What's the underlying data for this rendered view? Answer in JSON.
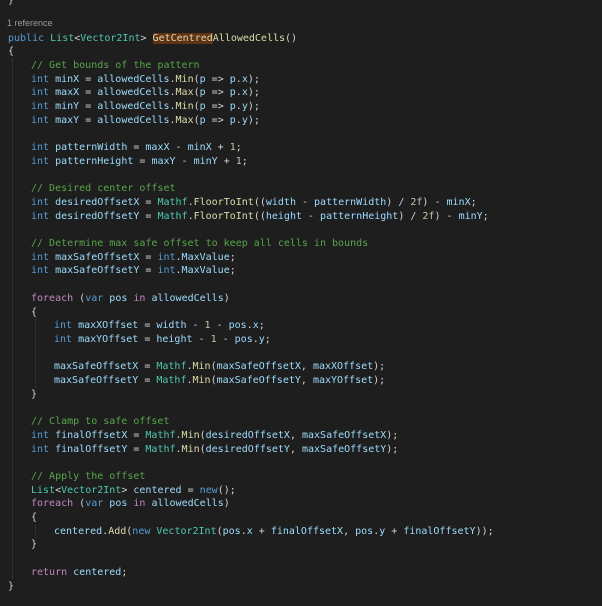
{
  "editor": {
    "code_lens": "1 reference",
    "colors": {
      "background": "#1e1e1e",
      "keyword": "#569cd6",
      "control": "#c586c0",
      "type": "#4ec9b0",
      "function": "#dcdcaa",
      "variable": "#9cdcfe",
      "number": "#b5cea8",
      "comment": "#57a64a",
      "text": "#d4d4d4",
      "highlight": "#613214"
    },
    "lines": [
      {
        "indent": 0,
        "tokens": [
          [
            "}",
            "pl"
          ]
        ]
      },
      {
        "indent": 0,
        "tokens": [
          [
            "public",
            "kw"
          ],
          [
            " ",
            "pl"
          ],
          [
            "List",
            "ty"
          ],
          [
            "<",
            "pl"
          ],
          [
            "Vector2Int",
            "ty"
          ],
          [
            "> ",
            "pl"
          ],
          [
            "GetCentred",
            "fn hl"
          ],
          [
            "AllowedCells",
            "fn"
          ],
          [
            "()",
            "pl"
          ]
        ]
      },
      {
        "indent": 0,
        "tokens": [
          [
            "{",
            "pl"
          ]
        ]
      },
      {
        "indent": 1,
        "tokens": [
          [
            "// Get bounds of the pattern",
            "cm"
          ]
        ]
      },
      {
        "indent": 1,
        "tokens": [
          [
            "int",
            "kw"
          ],
          [
            " ",
            "pl"
          ],
          [
            "minX",
            "vr"
          ],
          [
            " = ",
            "pl"
          ],
          [
            "allowedCells",
            "vr"
          ],
          [
            ".",
            "pl"
          ],
          [
            "Min",
            "fn"
          ],
          [
            "(",
            "pl"
          ],
          [
            "p",
            "vr"
          ],
          [
            " => ",
            "pl"
          ],
          [
            "p",
            "vr"
          ],
          [
            ".",
            "pl"
          ],
          [
            "x",
            "vr"
          ],
          [
            ");",
            "pl"
          ]
        ]
      },
      {
        "indent": 1,
        "tokens": [
          [
            "int",
            "kw"
          ],
          [
            " ",
            "pl"
          ],
          [
            "maxX",
            "vr"
          ],
          [
            " = ",
            "pl"
          ],
          [
            "allowedCells",
            "vr"
          ],
          [
            ".",
            "pl"
          ],
          [
            "Max",
            "fn"
          ],
          [
            "(",
            "pl"
          ],
          [
            "p",
            "vr"
          ],
          [
            " => ",
            "pl"
          ],
          [
            "p",
            "vr"
          ],
          [
            ".",
            "pl"
          ],
          [
            "x",
            "vr"
          ],
          [
            ");",
            "pl"
          ]
        ]
      },
      {
        "indent": 1,
        "tokens": [
          [
            "int",
            "kw"
          ],
          [
            " ",
            "pl"
          ],
          [
            "minY",
            "vr"
          ],
          [
            " = ",
            "pl"
          ],
          [
            "allowedCells",
            "vr"
          ],
          [
            ".",
            "pl"
          ],
          [
            "Min",
            "fn"
          ],
          [
            "(",
            "pl"
          ],
          [
            "p",
            "vr"
          ],
          [
            " => ",
            "pl"
          ],
          [
            "p",
            "vr"
          ],
          [
            ".",
            "pl"
          ],
          [
            "y",
            "vr"
          ],
          [
            ");",
            "pl"
          ]
        ]
      },
      {
        "indent": 1,
        "tokens": [
          [
            "int",
            "kw"
          ],
          [
            " ",
            "pl"
          ],
          [
            "maxY",
            "vr"
          ],
          [
            " = ",
            "pl"
          ],
          [
            "allowedCells",
            "vr"
          ],
          [
            ".",
            "pl"
          ],
          [
            "Max",
            "fn"
          ],
          [
            "(",
            "pl"
          ],
          [
            "p",
            "vr"
          ],
          [
            " => ",
            "pl"
          ],
          [
            "p",
            "vr"
          ],
          [
            ".",
            "pl"
          ],
          [
            "y",
            "vr"
          ],
          [
            ");",
            "pl"
          ]
        ]
      },
      {
        "indent": 0,
        "tokens": []
      },
      {
        "indent": 1,
        "tokens": [
          [
            "int",
            "kw"
          ],
          [
            " ",
            "pl"
          ],
          [
            "patternWidth",
            "vr"
          ],
          [
            " = ",
            "pl"
          ],
          [
            "maxX",
            "vr"
          ],
          [
            " - ",
            "pl"
          ],
          [
            "minX",
            "vr"
          ],
          [
            " + ",
            "pl"
          ],
          [
            "1",
            "nm"
          ],
          [
            ";",
            "pl"
          ]
        ]
      },
      {
        "indent": 1,
        "tokens": [
          [
            "int",
            "kw"
          ],
          [
            " ",
            "pl"
          ],
          [
            "patternHeight",
            "vr"
          ],
          [
            " = ",
            "pl"
          ],
          [
            "maxY",
            "vr"
          ],
          [
            " - ",
            "pl"
          ],
          [
            "minY",
            "vr"
          ],
          [
            " + ",
            "pl"
          ],
          [
            "1",
            "nm"
          ],
          [
            ";",
            "pl"
          ]
        ]
      },
      {
        "indent": 0,
        "tokens": []
      },
      {
        "indent": 1,
        "tokens": [
          [
            "// Desired center offset",
            "cm"
          ]
        ]
      },
      {
        "indent": 1,
        "tokens": [
          [
            "int",
            "kw"
          ],
          [
            " ",
            "pl"
          ],
          [
            "desiredOffsetX",
            "vr"
          ],
          [
            " = ",
            "pl"
          ],
          [
            "Mathf",
            "ty"
          ],
          [
            ".",
            "pl"
          ],
          [
            "FloorToInt",
            "fn"
          ],
          [
            "((",
            "pl"
          ],
          [
            "width",
            "vr"
          ],
          [
            " - ",
            "pl"
          ],
          [
            "patternWidth",
            "vr"
          ],
          [
            ") / ",
            "pl"
          ],
          [
            "2f",
            "nm"
          ],
          [
            ") - ",
            "pl"
          ],
          [
            "minX",
            "vr"
          ],
          [
            ";",
            "pl"
          ]
        ]
      },
      {
        "indent": 1,
        "tokens": [
          [
            "int",
            "kw"
          ],
          [
            " ",
            "pl"
          ],
          [
            "desiredOffsetY",
            "vr"
          ],
          [
            " = ",
            "pl"
          ],
          [
            "Mathf",
            "ty"
          ],
          [
            ".",
            "pl"
          ],
          [
            "FloorToInt",
            "fn"
          ],
          [
            "((",
            "pl"
          ],
          [
            "height",
            "vr"
          ],
          [
            " - ",
            "pl"
          ],
          [
            "patternHeight",
            "vr"
          ],
          [
            ") / ",
            "pl"
          ],
          [
            "2f",
            "nm"
          ],
          [
            ") - ",
            "pl"
          ],
          [
            "minY",
            "vr"
          ],
          [
            ";",
            "pl"
          ]
        ]
      },
      {
        "indent": 0,
        "tokens": []
      },
      {
        "indent": 1,
        "tokens": [
          [
            "// Determine max safe offset to keep all cells in bounds",
            "cm"
          ]
        ]
      },
      {
        "indent": 1,
        "tokens": [
          [
            "int",
            "kw"
          ],
          [
            " ",
            "pl"
          ],
          [
            "maxSafeOffsetX",
            "vr"
          ],
          [
            " = ",
            "pl"
          ],
          [
            "int",
            "kw"
          ],
          [
            ".",
            "pl"
          ],
          [
            "MaxValue",
            "vr"
          ],
          [
            ";",
            "pl"
          ]
        ]
      },
      {
        "indent": 1,
        "tokens": [
          [
            "int",
            "kw"
          ],
          [
            " ",
            "pl"
          ],
          [
            "maxSafeOffsetY",
            "vr"
          ],
          [
            " = ",
            "pl"
          ],
          [
            "int",
            "kw"
          ],
          [
            ".",
            "pl"
          ],
          [
            "MaxValue",
            "vr"
          ],
          [
            ";",
            "pl"
          ]
        ]
      },
      {
        "indent": 0,
        "tokens": []
      },
      {
        "indent": 1,
        "tokens": [
          [
            "foreach",
            "ctl"
          ],
          [
            " (",
            "pl"
          ],
          [
            "var",
            "kw"
          ],
          [
            " ",
            "pl"
          ],
          [
            "pos",
            "vr"
          ],
          [
            " ",
            "pl"
          ],
          [
            "in",
            "ctl"
          ],
          [
            " ",
            "pl"
          ],
          [
            "allowedCells",
            "vr"
          ],
          [
            ")",
            "pl"
          ]
        ]
      },
      {
        "indent": 1,
        "tokens": [
          [
            "{",
            "pl"
          ]
        ]
      },
      {
        "indent": 2,
        "tokens": [
          [
            "int",
            "kw"
          ],
          [
            " ",
            "pl"
          ],
          [
            "maxXOffset",
            "vr"
          ],
          [
            " = ",
            "pl"
          ],
          [
            "width",
            "vr"
          ],
          [
            " - ",
            "pl"
          ],
          [
            "1",
            "nm"
          ],
          [
            " - ",
            "pl"
          ],
          [
            "pos",
            "vr"
          ],
          [
            ".",
            "pl"
          ],
          [
            "x",
            "vr"
          ],
          [
            ";",
            "pl"
          ]
        ]
      },
      {
        "indent": 2,
        "tokens": [
          [
            "int",
            "kw"
          ],
          [
            " ",
            "pl"
          ],
          [
            "maxYOffset",
            "vr"
          ],
          [
            " = ",
            "pl"
          ],
          [
            "height",
            "vr"
          ],
          [
            " - ",
            "pl"
          ],
          [
            "1",
            "nm"
          ],
          [
            " - ",
            "pl"
          ],
          [
            "pos",
            "vr"
          ],
          [
            ".",
            "pl"
          ],
          [
            "y",
            "vr"
          ],
          [
            ";",
            "pl"
          ]
        ]
      },
      {
        "indent": 0,
        "tokens": []
      },
      {
        "indent": 2,
        "tokens": [
          [
            "maxSafeOffsetX",
            "vr"
          ],
          [
            " = ",
            "pl"
          ],
          [
            "Mathf",
            "ty"
          ],
          [
            ".",
            "pl"
          ],
          [
            "Min",
            "fn"
          ],
          [
            "(",
            "pl"
          ],
          [
            "maxSafeOffsetX",
            "vr"
          ],
          [
            ", ",
            "pl"
          ],
          [
            "maxXOffset",
            "vr"
          ],
          [
            ");",
            "pl"
          ]
        ]
      },
      {
        "indent": 2,
        "tokens": [
          [
            "maxSafeOffsetY",
            "vr"
          ],
          [
            " = ",
            "pl"
          ],
          [
            "Mathf",
            "ty"
          ],
          [
            ".",
            "pl"
          ],
          [
            "Min",
            "fn"
          ],
          [
            "(",
            "pl"
          ],
          [
            "maxSafeOffsetY",
            "vr"
          ],
          [
            ", ",
            "pl"
          ],
          [
            "maxYOffset",
            "vr"
          ],
          [
            ");",
            "pl"
          ]
        ]
      },
      {
        "indent": 1,
        "tokens": [
          [
            "}",
            "pl"
          ]
        ]
      },
      {
        "indent": 0,
        "tokens": []
      },
      {
        "indent": 1,
        "tokens": [
          [
            "// Clamp to safe offset",
            "cm"
          ]
        ]
      },
      {
        "indent": 1,
        "tokens": [
          [
            "int",
            "kw"
          ],
          [
            " ",
            "pl"
          ],
          [
            "finalOffsetX",
            "vr"
          ],
          [
            " = ",
            "pl"
          ],
          [
            "Mathf",
            "ty"
          ],
          [
            ".",
            "pl"
          ],
          [
            "Min",
            "fn"
          ],
          [
            "(",
            "pl"
          ],
          [
            "desiredOffsetX",
            "vr"
          ],
          [
            ", ",
            "pl"
          ],
          [
            "maxSafeOffsetX",
            "vr"
          ],
          [
            ");",
            "pl"
          ]
        ]
      },
      {
        "indent": 1,
        "tokens": [
          [
            "int",
            "kw"
          ],
          [
            " ",
            "pl"
          ],
          [
            "finalOffsetY",
            "vr"
          ],
          [
            " = ",
            "pl"
          ],
          [
            "Mathf",
            "ty"
          ],
          [
            ".",
            "pl"
          ],
          [
            "Min",
            "fn"
          ],
          [
            "(",
            "pl"
          ],
          [
            "desiredOffsetY",
            "vr"
          ],
          [
            ", ",
            "pl"
          ],
          [
            "maxSafeOffsetY",
            "vr"
          ],
          [
            ");",
            "pl"
          ]
        ]
      },
      {
        "indent": 0,
        "tokens": []
      },
      {
        "indent": 1,
        "tokens": [
          [
            "// Apply the offset",
            "cm"
          ]
        ]
      },
      {
        "indent": 1,
        "tokens": [
          [
            "List",
            "ty"
          ],
          [
            "<",
            "pl"
          ],
          [
            "Vector2Int",
            "ty"
          ],
          [
            "> ",
            "pl"
          ],
          [
            "centered",
            "vr"
          ],
          [
            " = ",
            "pl"
          ],
          [
            "new",
            "kw"
          ],
          [
            "();",
            "pl"
          ]
        ]
      },
      {
        "indent": 1,
        "tokens": [
          [
            "foreach",
            "ctl"
          ],
          [
            " (",
            "pl"
          ],
          [
            "var",
            "kw"
          ],
          [
            " ",
            "pl"
          ],
          [
            "pos",
            "vr"
          ],
          [
            " ",
            "pl"
          ],
          [
            "in",
            "ctl"
          ],
          [
            " ",
            "pl"
          ],
          [
            "allowedCells",
            "vr"
          ],
          [
            ")",
            "pl"
          ]
        ]
      },
      {
        "indent": 1,
        "tokens": [
          [
            "{",
            "pl"
          ]
        ]
      },
      {
        "indent": 2,
        "tokens": [
          [
            "centered",
            "vr"
          ],
          [
            ".",
            "pl"
          ],
          [
            "Add",
            "fn"
          ],
          [
            "(",
            "pl"
          ],
          [
            "new",
            "kw"
          ],
          [
            " ",
            "pl"
          ],
          [
            "Vector2Int",
            "ty"
          ],
          [
            "(",
            "pl"
          ],
          [
            "pos",
            "vr"
          ],
          [
            ".",
            "pl"
          ],
          [
            "x",
            "vr"
          ],
          [
            " + ",
            "pl"
          ],
          [
            "finalOffsetX",
            "vr"
          ],
          [
            ", ",
            "pl"
          ],
          [
            "pos",
            "vr"
          ],
          [
            ".",
            "pl"
          ],
          [
            "y",
            "vr"
          ],
          [
            " + ",
            "pl"
          ],
          [
            "finalOffsetY",
            "vr"
          ],
          [
            "));",
            "pl"
          ]
        ]
      },
      {
        "indent": 1,
        "tokens": [
          [
            "}",
            "pl"
          ]
        ]
      },
      {
        "indent": 0,
        "tokens": []
      },
      {
        "indent": 1,
        "tokens": [
          [
            "return",
            "ctl"
          ],
          [
            " ",
            "pl"
          ],
          [
            "centered",
            "vr"
          ],
          [
            ";",
            "pl"
          ]
        ]
      },
      {
        "indent": 0,
        "tokens": [
          [
            "}",
            "pl"
          ]
        ]
      }
    ]
  }
}
